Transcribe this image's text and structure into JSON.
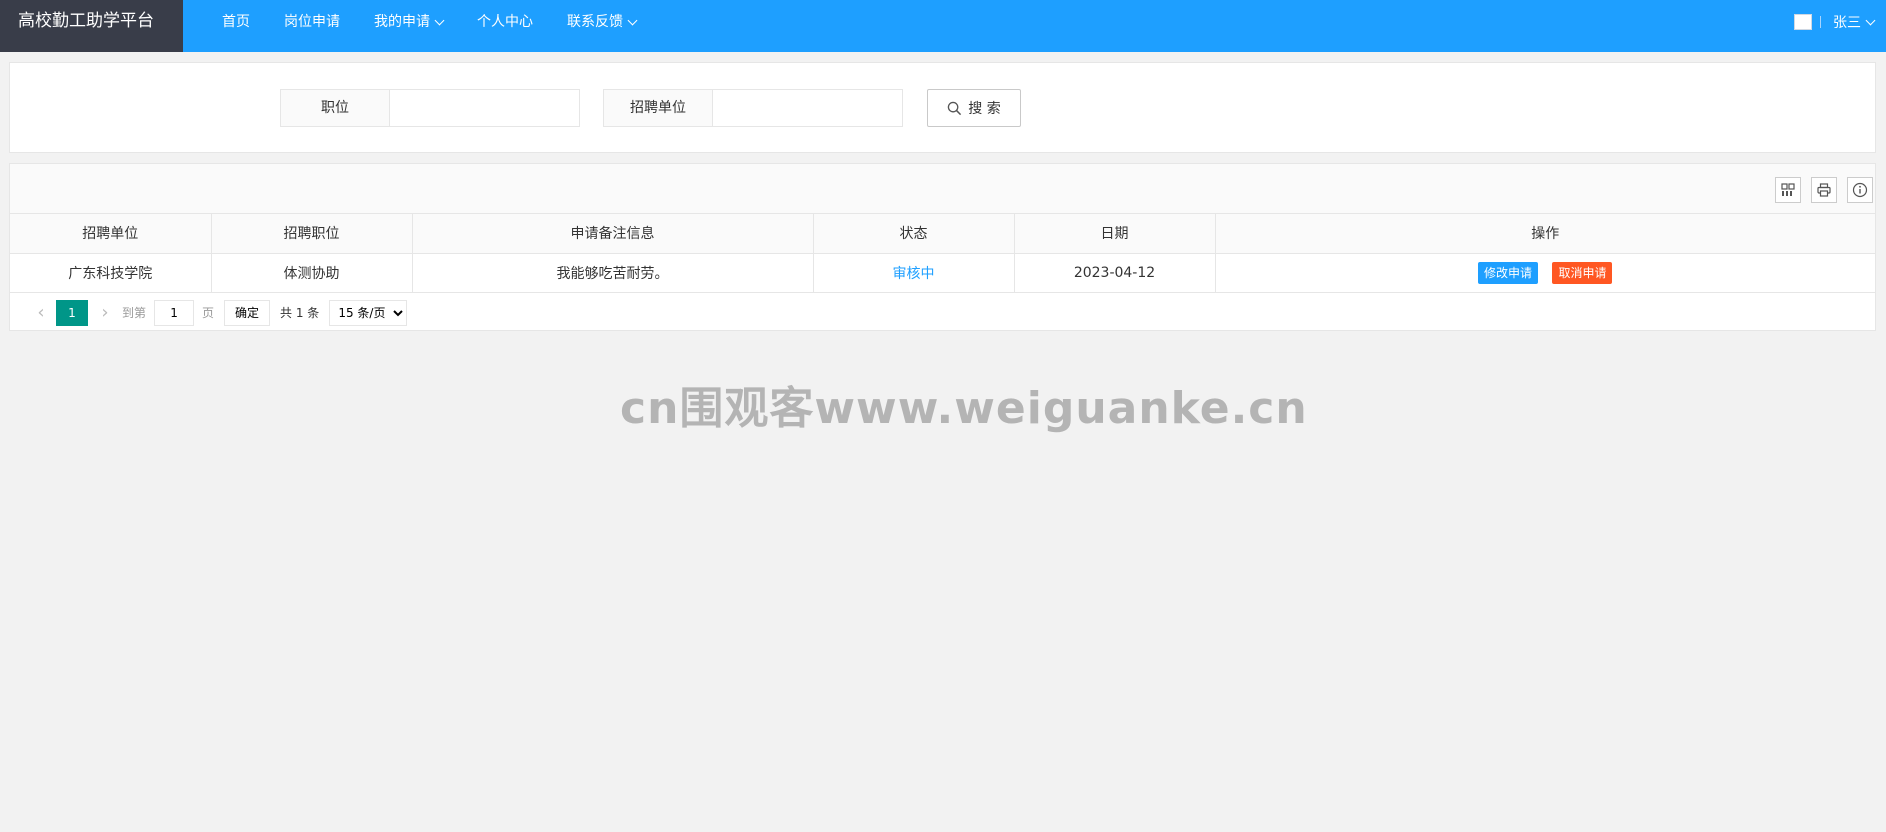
{
  "header": {
    "logo": "高校勤工助学平台",
    "nav": [
      {
        "label": "首页",
        "has_dropdown": false
      },
      {
        "label": "岗位申请",
        "has_dropdown": false
      },
      {
        "label": "我的申请",
        "has_dropdown": true
      },
      {
        "label": "个人中心",
        "has_dropdown": false
      },
      {
        "label": "联系反馈",
        "has_dropdown": true
      }
    ],
    "user_name": "张三"
  },
  "search": {
    "position_label": "职位",
    "position_value": "",
    "unit_label": "招聘单位",
    "unit_value": "",
    "button_label": "搜 索"
  },
  "table": {
    "columns": [
      "招聘单位",
      "招聘职位",
      "申请备注信息",
      "状态",
      "日期",
      "操作"
    ],
    "rows": [
      {
        "unit": "广东科技学院",
        "position": "体测协助",
        "remark": "我能够吃苦耐劳。",
        "status": "审核中",
        "date": "2023-04-12",
        "edit_label": "修改申请",
        "cancel_label": "取消申请"
      }
    ]
  },
  "pager": {
    "current_page": "1",
    "goto_prefix": "到第",
    "goto_value": "1",
    "goto_suffix": "页",
    "confirm_label": "确定",
    "total_text": "共 1 条",
    "page_size": "15 条/页"
  },
  "watermark": "cn围观客www.weiguanke.cn",
  "colors": {
    "header_bg": "#1e9fff",
    "logo_bg": "#393d49",
    "page_active": "#009688",
    "btn_edit": "#1e9fff",
    "btn_cancel": "#ff5722"
  }
}
